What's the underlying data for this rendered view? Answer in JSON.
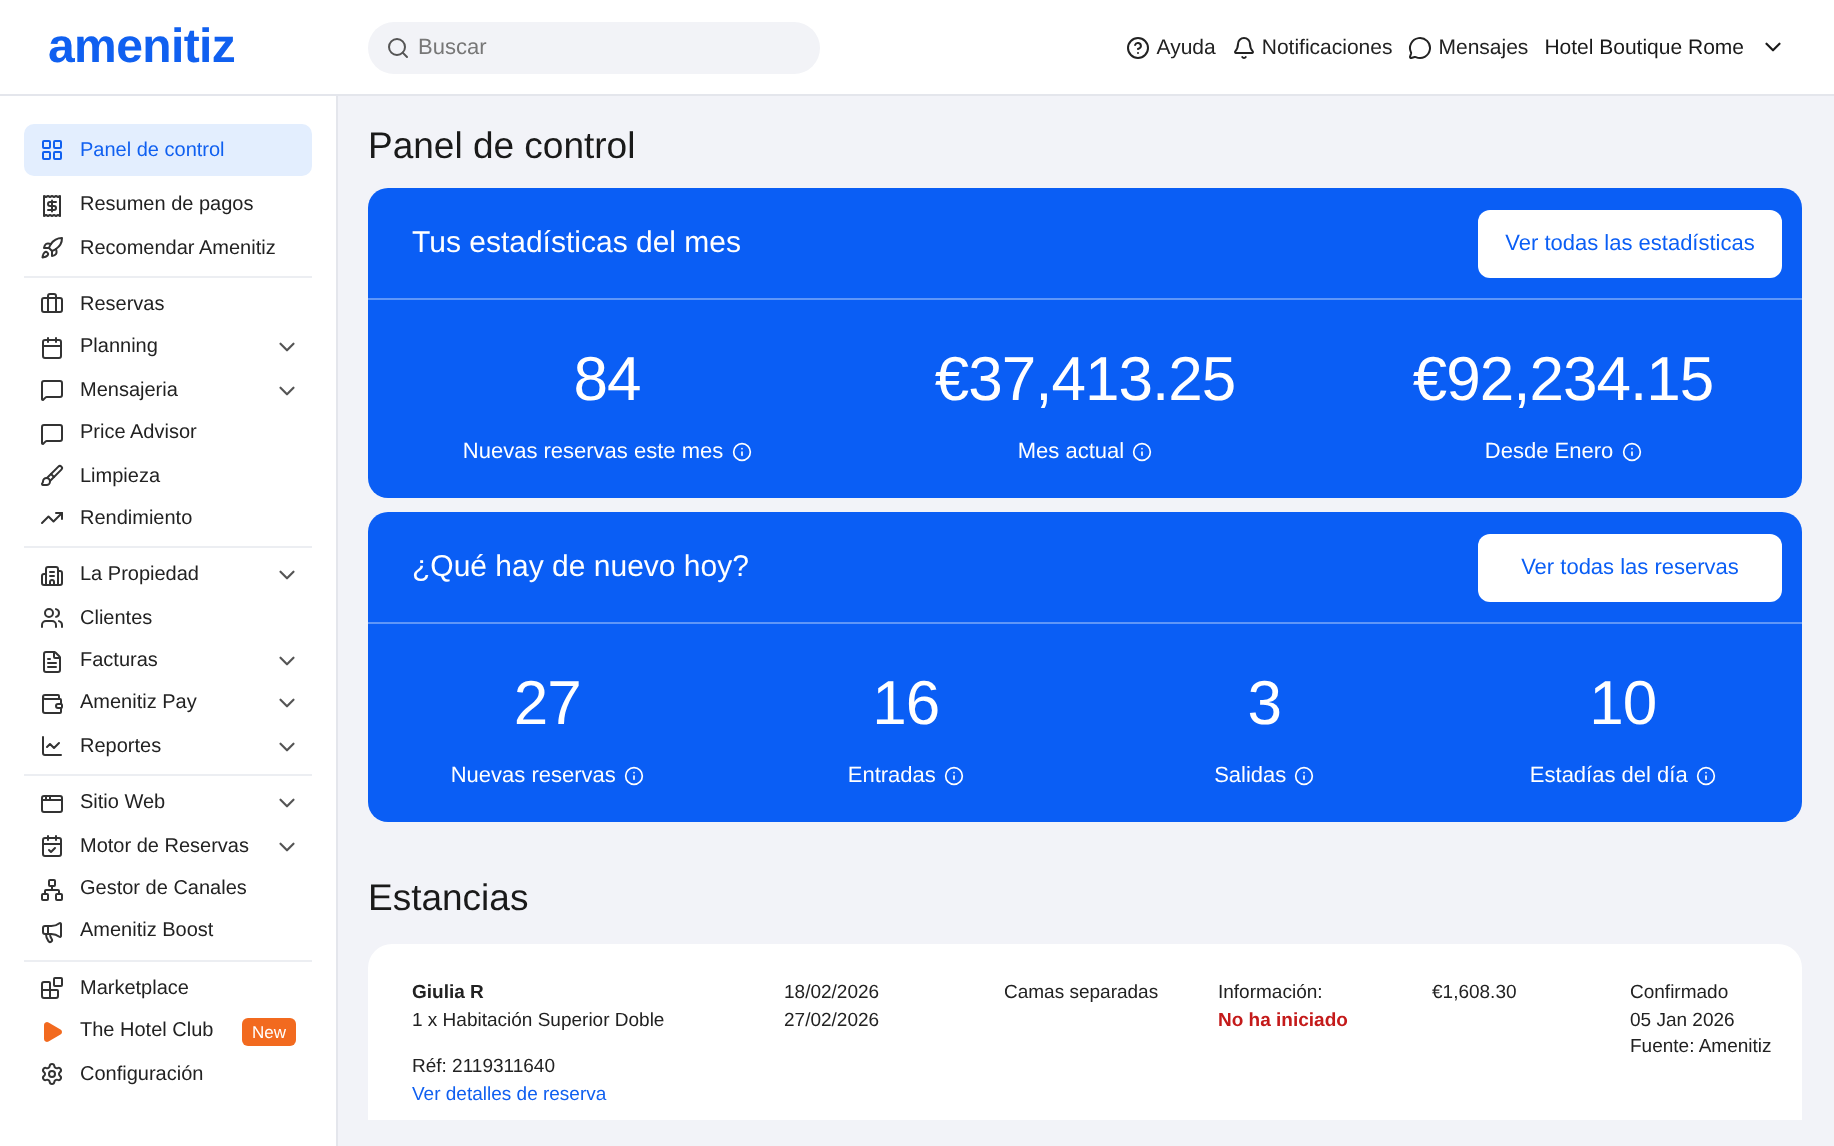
{
  "header": {
    "logo": "amenitiz",
    "search": {
      "placeholder": "Buscar"
    },
    "links": [
      {
        "kind": "help",
        "label": "Ayuda"
      },
      {
        "kind": "bell",
        "label": "Notificaciones"
      },
      {
        "kind": "chat",
        "label": "Mensajes"
      }
    ],
    "property": "Hotel Boutique Rome"
  },
  "sidebar": {
    "groups": [
      [
        {
          "label": "Panel de control",
          "selected": true,
          "expandable": false
        },
        {
          "label": "Resumen de pagos",
          "selected": false,
          "expandable": false
        },
        {
          "label": "Recomendar Amenitiz",
          "selected": false,
          "expandable": false
        }
      ],
      [
        {
          "label": "Reservas",
          "selected": false,
          "expandable": false
        },
        {
          "label": "Planning",
          "selected": false,
          "expandable": true
        },
        {
          "label": "Mensajeria",
          "selected": false,
          "expandable": true
        },
        {
          "label": "Price Advisor",
          "selected": false,
          "expandable": false
        },
        {
          "label": "Limpieza",
          "selected": false,
          "expandable": false
        },
        {
          "label": "Rendimiento",
          "selected": false,
          "expandable": false
        }
      ],
      [
        {
          "label": "La Propiedad",
          "selected": false,
          "expandable": true
        },
        {
          "label": "Clientes",
          "selected": false,
          "expandable": false
        },
        {
          "label": "Facturas",
          "selected": false,
          "expandable": true
        },
        {
          "label": "Amenitiz Pay",
          "selected": false,
          "expandable": true
        },
        {
          "label": "Reportes",
          "selected": false,
          "expandable": true
        }
      ],
      [
        {
          "label": "Sitio Web",
          "selected": false,
          "expandable": true
        },
        {
          "label": "Motor de Reservas",
          "selected": false,
          "expandable": true
        },
        {
          "label": "Gestor de Canales",
          "selected": false,
          "expandable": false
        },
        {
          "label": "Amenitiz Boost",
          "selected": false,
          "expandable": false
        }
      ],
      [
        {
          "label": "Marketplace",
          "selected": false,
          "expandable": false
        },
        {
          "label": "The Hotel Club",
          "selected": false,
          "expandable": false,
          "badge": "New"
        },
        {
          "label": "Configuración",
          "selected": false,
          "expandable": false
        }
      ]
    ]
  },
  "page_title": "Panel de control",
  "stat_cards": [
    {
      "title": "Tus estadísticas del mes",
      "button": "Ver todas las estadísticas",
      "stats": [
        {
          "value": "84",
          "label": "Nuevas reservas este mes"
        },
        {
          "value": "€37,413.25",
          "label": "Mes actual"
        },
        {
          "value": "€92,234.15",
          "label": "Desde Enero"
        }
      ]
    },
    {
      "title": "¿Qué hay de nuevo hoy?",
      "button": "Ver todas las reservas",
      "stats": [
        {
          "value": "27",
          "label": "Nuevas reservas"
        },
        {
          "value": "16",
          "label": "Entradas"
        },
        {
          "value": "3",
          "label": "Salidas"
        },
        {
          "value": "10",
          "label": "Estadías del día"
        }
      ]
    }
  ],
  "stays": {
    "title": "Estancias",
    "rows": [
      {
        "guest": "Giulia R",
        "room": "1 x Habitación Superior Doble",
        "ref": "Réf: 2119311640",
        "link": "Ver detalles de reserva",
        "check_in": "18/02/2026",
        "check_out": "27/02/2026",
        "beds": "Camas separadas",
        "info_label": "Información:",
        "info_status": "No ha iniciado",
        "price": "€1,608.30",
        "status": "Confirmado",
        "date": "05 Jan 2026",
        "source": "Fuente: Amenitiz"
      }
    ]
  }
}
